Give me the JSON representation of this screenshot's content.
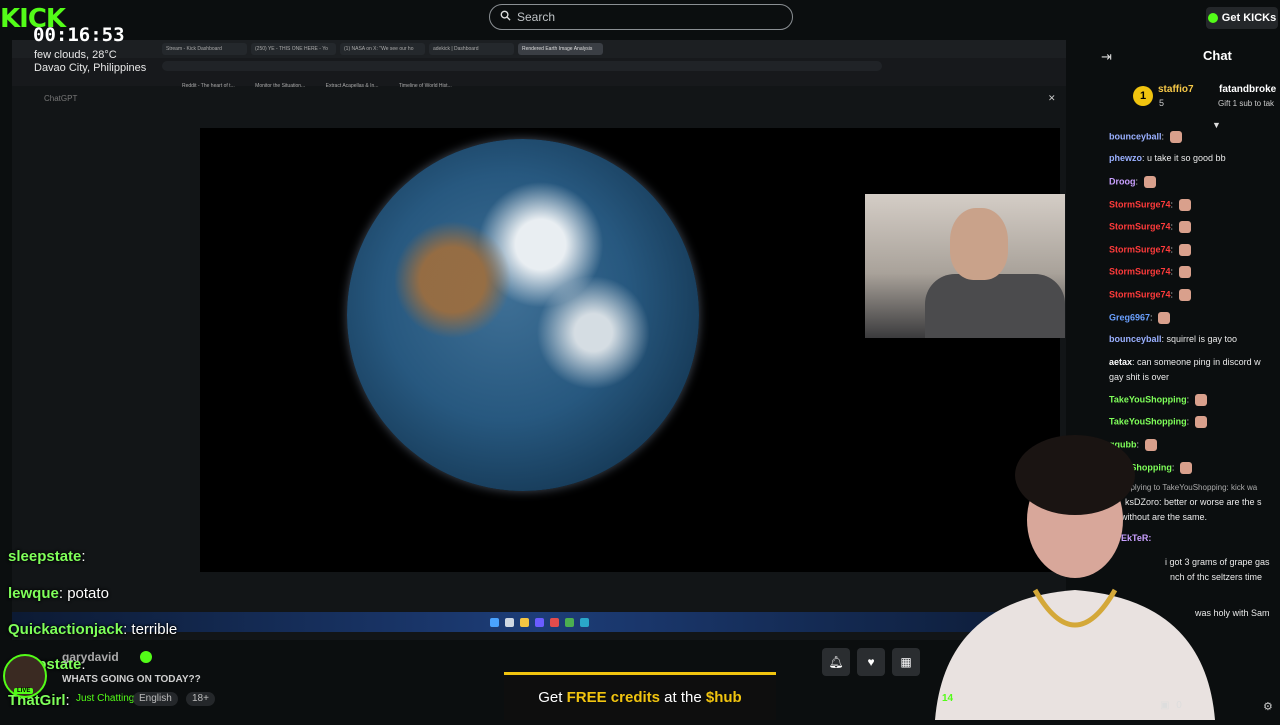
{
  "header": {
    "logo": "KICK",
    "search_placeholder": "Search",
    "get_kicks_label": "Get KICKs"
  },
  "overlay": {
    "timer": "00:16:53",
    "weather_line1": "few clouds, 28°C",
    "weather_line2": "Davao City, Philippines"
  },
  "browser": {
    "tabs": [
      "Stream - Kick Dashboard",
      "(250) YE - THIS ONE HERE - Yo",
      "(1) NASA on X: \"We see our ho",
      "adekick | Dashboard",
      "Rendered Earth Image Analysis"
    ],
    "app_title": "ChatGPT",
    "bookmarks": [
      "Reddit - The heart of t...",
      "Monitor the Situation...",
      "Extract Acapellas & In...",
      "Timeline of World Hist..."
    ]
  },
  "right_chat": {
    "title": "Chat",
    "pinned_user1": "staffio7",
    "pinned_user2": "fatandbroke",
    "pinned_text": "Gift 1 sub to tak",
    "pinned_count": "5",
    "messages": [
      {
        "user": "bounceyball",
        "text": "",
        "color": "#9ab0ff"
      },
      {
        "user": "phewzo",
        "text": "u take it so good bb",
        "color": "#9ab0ff"
      },
      {
        "user": "Droog",
        "text": "",
        "color": "#c9a0ff"
      },
      {
        "user": "StormSurge74",
        "text": "",
        "color": "#ff3b3b"
      },
      {
        "user": "StormSurge74",
        "text": "",
        "color": "#ff3b3b"
      },
      {
        "user": "StormSurge74",
        "text": "",
        "color": "#ff3b3b"
      },
      {
        "user": "StormSurge74",
        "text": "",
        "color": "#ff3b3b"
      },
      {
        "user": "StormSurge74",
        "text": "",
        "color": "#ff3b3b"
      },
      {
        "user": "Greg6967",
        "text": "",
        "color": "#6aa0ff"
      },
      {
        "user": "bounceyball",
        "text": "squirrel is gay too",
        "color": "#9ab0ff"
      },
      {
        "user": "aetax",
        "text": "can someone ping in discord w",
        "color": "#ffffff"
      },
      {
        "user": "",
        "text": "gay shit is over",
        "color": "#ffffff"
      },
      {
        "user": "TakeYouShopping",
        "text": "",
        "color": "#7fff5a"
      },
      {
        "user": "TakeYouShopping",
        "text": "",
        "color": "#7fff5a"
      },
      {
        "user": "ggubb",
        "text": "",
        "color": "#7fff5a"
      },
      {
        "user": "eYouShopping",
        "text": "",
        "color": "#7fff5a"
      }
    ],
    "partial_lines": [
      "eplying to TakeYouShopping: kick wa",
      "ksDZoro: better or worse are the s",
      "without are the same.",
      "EkTeR:",
      "i got 3 grams of grape gas",
      "nch of thc seltzers time",
      "was holy with Sam"
    ],
    "bottom_count": "0"
  },
  "left_chat": [
    {
      "user": "sleepstate",
      "text": ""
    },
    {
      "user": "lewque",
      "text": "potato"
    },
    {
      "user": "Quickactionjack",
      "text": "terrible"
    },
    {
      "user": "sleepstate",
      "text": ""
    },
    {
      "user": "ThatGirl",
      "text": ""
    }
  ],
  "stream_info": {
    "streamer": "garydavid",
    "title": "WHATS GOING ON TODAY??",
    "category": "Just Chatting",
    "language": "English",
    "rating": "18+",
    "live": "LIVE",
    "viewers": "14"
  },
  "banner": {
    "prefix": "Get ",
    "highlight": "FREE credits",
    "middle": " at the ",
    "brand": "$hub"
  }
}
